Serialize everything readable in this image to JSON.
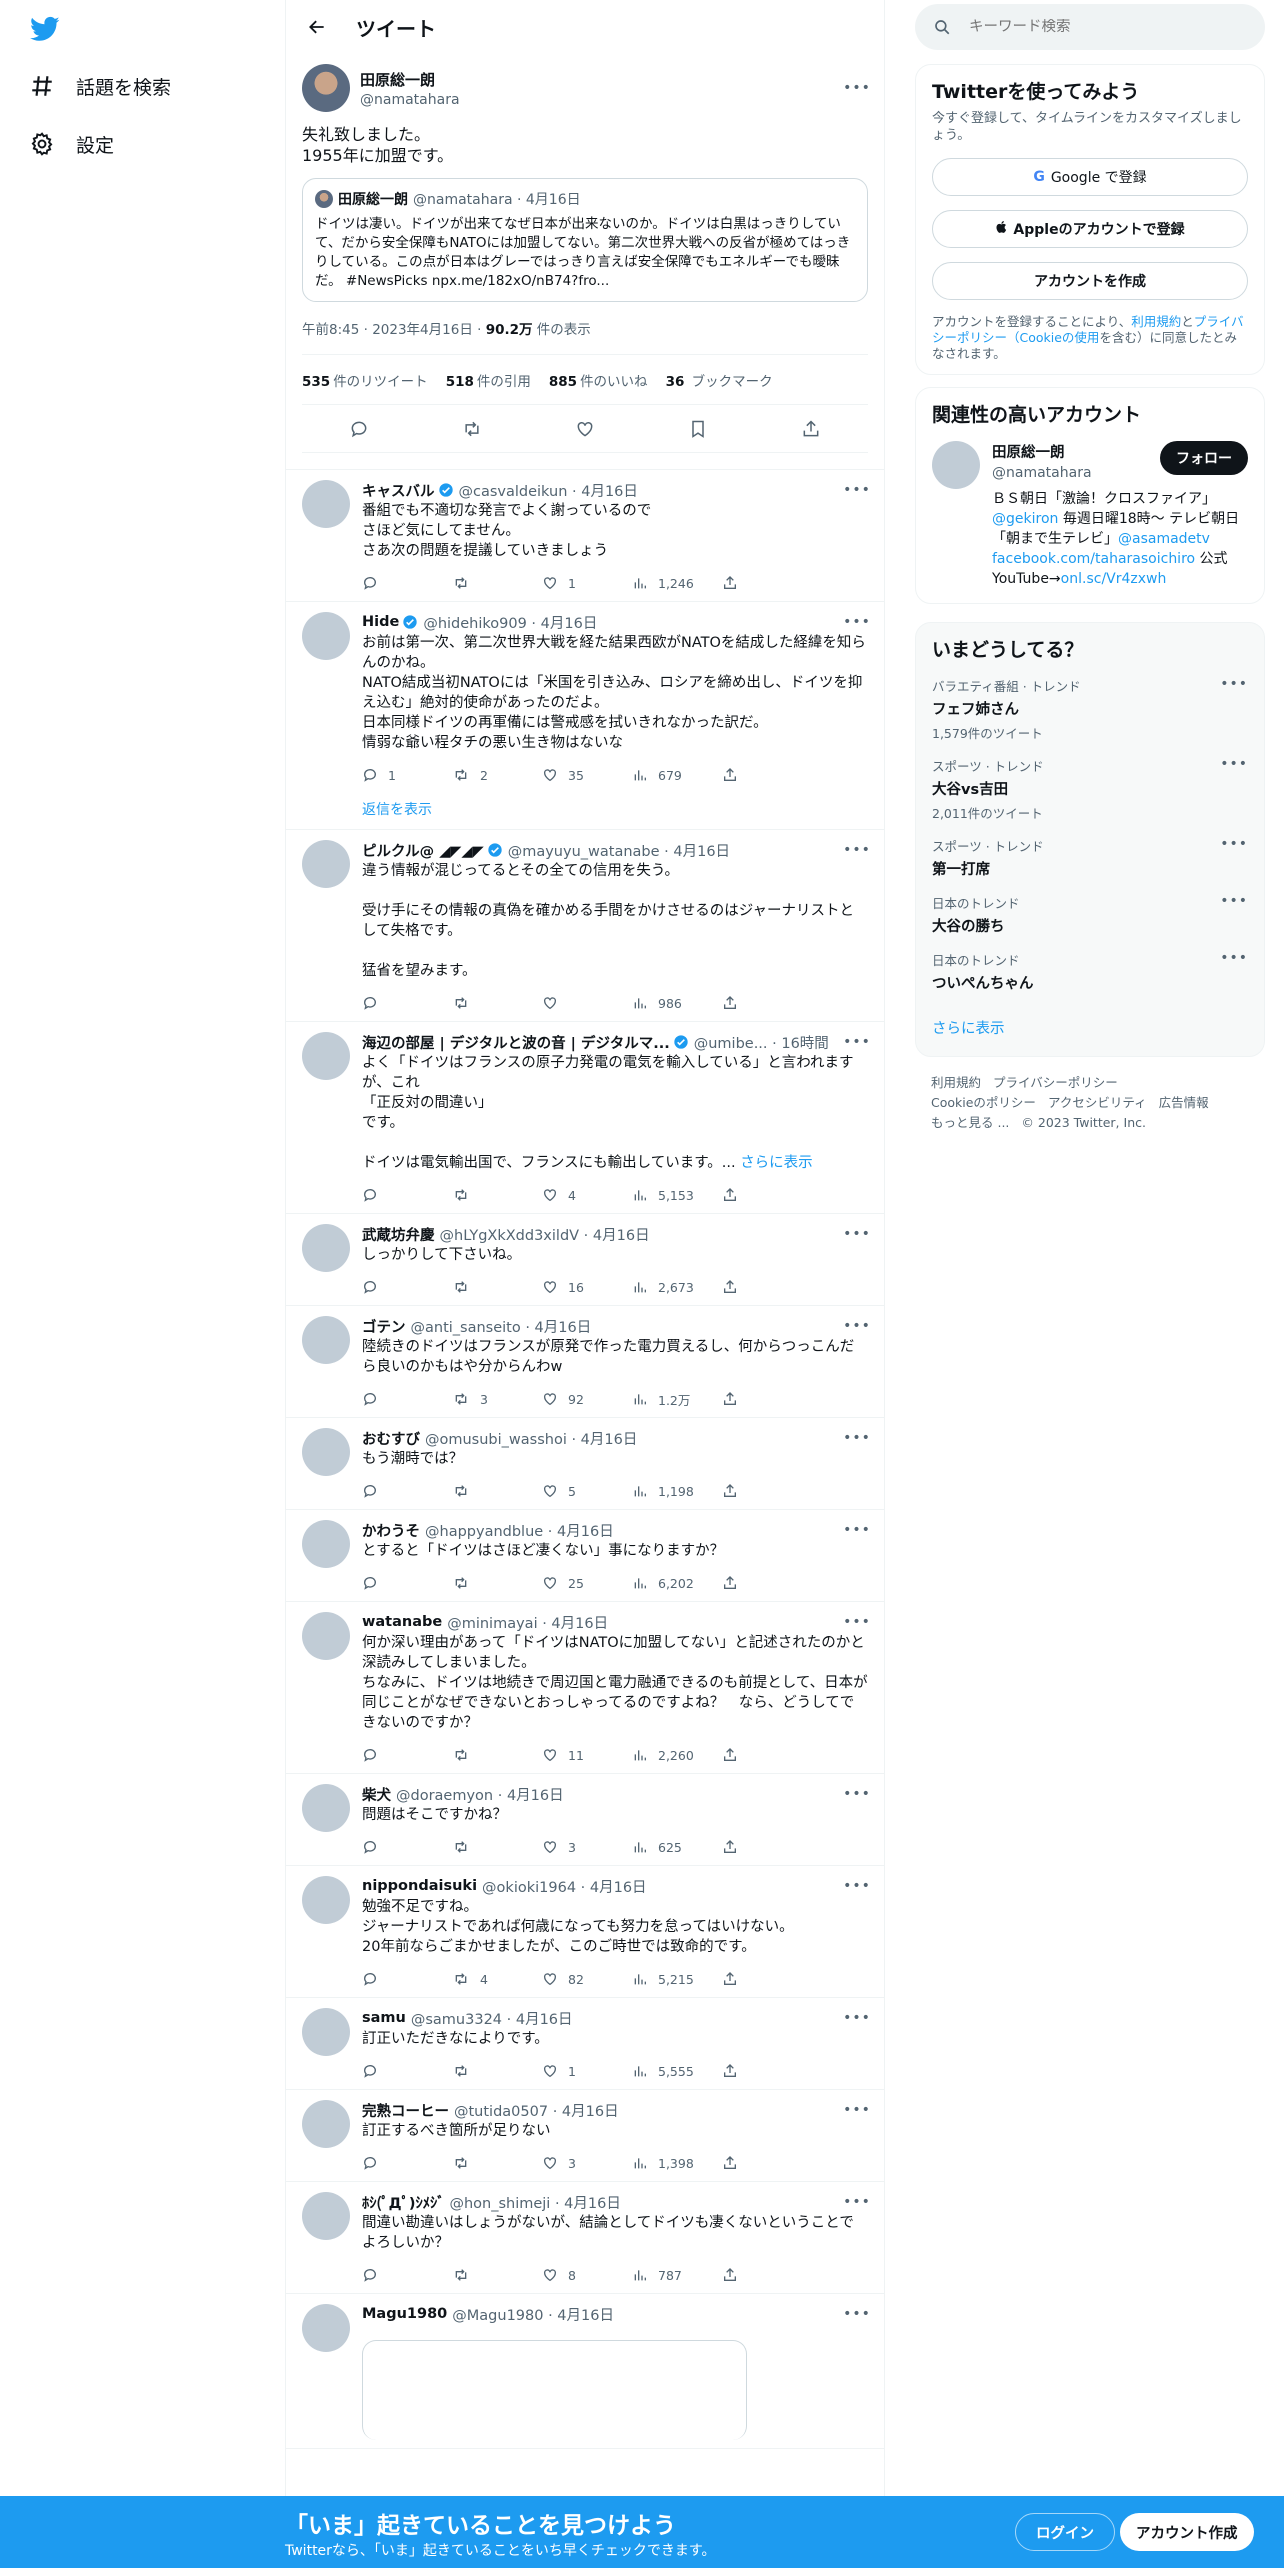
{
  "nav": {
    "explore": "話題を検索",
    "settings": "設定"
  },
  "header": {
    "title": "ツイート"
  },
  "focal": {
    "name": "田原総一朗",
    "handle": "@namatahara",
    "text": "失礼致しました。\n1955年に加盟です。",
    "quote": {
      "name": "田原総一朗",
      "meta": "@namatahara · 4月16日",
      "text": "ドイツは凄い。ドイツが出来てなぜ日本が出来ないのか。ドイツは白黒はっきりしていて、だから安全保障もNATOには加盟してない。第二次世界大戦への反省が極めてはっきりしている。この点が日本はグレーではっきり言えば安全保障でもエネルギーでも曖昧だ。 #NewsPicks npx.me/182xO/nB74?fro..."
    },
    "time": "午前8:45 · 2023年4月16日 · ",
    "views": "90.2万",
    "views_label": " 件の表示",
    "stats": {
      "retweets": "535",
      "retweets_label": "件のリツイート",
      "quotes": "518",
      "quotes_label": "件の引用",
      "likes": "885",
      "likes_label": "件のいいね",
      "bookmarks": "36",
      "bookmarks_label": "ブックマーク"
    }
  },
  "replies": [
    {
      "name": "キャスバル",
      "handle": "@casvaldeikun · 4月16日",
      "verified": true,
      "text": "番組でも不適切な発言でよく謝っているので\nさほど気にしてません。\nさあ次の問題を提議していきましょう",
      "reply": "",
      "rt": "",
      "like": "1",
      "views": "1,246"
    },
    {
      "name": "Hide",
      "handle": "@hidehiko909 · 4月16日",
      "verified": true,
      "text": "お前は第一次、第二次世界大戦を経た結果西欧がNATOを結成した経緯を知らんのかね。\nNATO結成当初NATOには「米国を引き込み、ロシアを締め出し、ドイツを抑え込む」絶対的使命があったのだよ。\n日本同様ドイツの再軍備には警戒感を拭いきれなかった訳だ。\n情弱な爺い程タチの悪い生き物はないな",
      "reply": "1",
      "rt": "2",
      "like": "35",
      "views": "679"
    },
    {
      "name": "ピルクル@ ◢◤◢◤",
      "handle": "@mayuyu_watanabe · 4月16日",
      "verified": true,
      "text": "違う情報が混じってるとその全ての信用を失う。\n\n受け手にその情報の真偽を確かめる手間をかけさせるのはジャーナリストとして失格です。\n\n猛省を望みます。",
      "reply": "",
      "rt": "",
      "like": "",
      "views": "986"
    },
    {
      "name": "海辺の部屋 | デジタルと波の音 | デジタルマ...",
      "handle": "@umibe... · 16時間",
      "verified": true,
      "text": "よく「ドイツはフランスの原子力発電の電気を輸入している」と言われますが、これ\n「正反対の間違い」\nです。\n\nドイツは電気輸出国で、フランスにも輸出しています。...",
      "more": "さらに表示",
      "reply": "",
      "rt": "",
      "like": "4",
      "views": "5,153"
    },
    {
      "name": "武蔵坊弁慶",
      "handle": "@hLYgXkXdd3xildV · 4月16日",
      "verified": false,
      "text": "しっかりして下さいね。",
      "reply": "",
      "rt": "",
      "like": "16",
      "views": "2,673"
    },
    {
      "name": "ゴテン",
      "handle": "@anti_sanseito · 4月16日",
      "verified": false,
      "text": "陸続きのドイツはフランスが原発で作った電力買えるし、何からつっこんだら良いのかもはや分からんわw",
      "reply": "",
      "rt": "3",
      "like": "92",
      "views": "1.2万"
    },
    {
      "name": "おむすび",
      "handle": "@omusubi_wasshoi · 4月16日",
      "verified": false,
      "text": "もう潮時では？",
      "reply": "",
      "rt": "",
      "like": "5",
      "views": "1,198"
    },
    {
      "name": "かわうそ",
      "handle": "@happyandblue · 4月16日",
      "verified": false,
      "text": "とすると「ドイツはさほど凄くない」事になりますか？",
      "reply": "",
      "rt": "",
      "like": "25",
      "views": "6,202"
    },
    {
      "name": "watanabe",
      "handle": "@minimayai · 4月16日",
      "verified": false,
      "text": "何か深い理由があって「ドイツはNATOに加盟してない」と記述されたのかと深読みしてしまいました。\nちなみに、ドイツは地続きで周辺国と電力融通できるのも前提として、日本が同じことがなぜできないとおっしゃってるのですよね？　なら、どうしてできないのですか？",
      "reply": "",
      "rt": "",
      "like": "11",
      "views": "2,260"
    },
    {
      "name": "柴犬",
      "handle": "@doraemyon · 4月16日",
      "verified": false,
      "text": "問題はそこですかね？",
      "reply": "",
      "rt": "",
      "like": "3",
      "views": "625"
    },
    {
      "name": "nippondaisuki",
      "handle": "@okioki1964 · 4月16日",
      "verified": false,
      "text": "勉強不足ですね。\nジャーナリストであれば何歳になっても努力を怠ってはいけない。\n20年前ならごまかせましたが、このご時世では致命的です。",
      "reply": "",
      "rt": "4",
      "like": "82",
      "views": "5,215"
    },
    {
      "name": "samu",
      "handle": "@samu3324 · 4月16日",
      "verified": false,
      "text": "訂正いただきなによりです。",
      "reply": "",
      "rt": "",
      "like": "1",
      "views": "5,555"
    },
    {
      "name": "完熟コーヒー",
      "handle": "@tutida0507 · 4月16日",
      "verified": false,
      "text": "訂正するべき箇所が足りない",
      "reply": "",
      "rt": "",
      "like": "3",
      "views": "1,398"
    },
    {
      "name": "ﾎｼ(ﾟДﾟ)ｼﾒｼﾞ",
      "handle": "@hon_shimeji · 4月16日",
      "verified": false,
      "text": "間違い勘違いはしょうがないが、結論としてドイツも凄くないということでよろしいか？",
      "reply": "",
      "rt": "",
      "like": "8",
      "views": "787"
    },
    {
      "name": "Magu1980",
      "handle": "@Magu1980 · 4月16日",
      "verified": false,
      "text": "",
      "reply": "",
      "rt": "",
      "like": "",
      "views": ""
    }
  ],
  "show_replies": "返信を表示",
  "right": {
    "search_placeholder": "キーワード検索",
    "signup": {
      "title": "Twitterを使ってみよう",
      "sub": "今すぐ登録して、タイムラインをカスタマイズしましょう。",
      "google": "Google で登録",
      "apple": "Appleのアカウントで登録",
      "create": "アカウントを作成",
      "note_a": "アカウントを登録することにより、",
      "note_terms": "利用規約",
      "note_b": "と",
      "note_privacy": "プライバシーポリシー（Cookieの使用",
      "note_c": "を含む）に同意したとみなされます。"
    },
    "related": {
      "title": "関連性の高いアカウント",
      "name": "田原総一朗",
      "handle": "@namatahara",
      "follow": "フォロー",
      "bio_a": "ＢＳ朝日「激論！クロスファイア」",
      "bio_gekiron": "@gekiron",
      "bio_b": " 毎週日曜18時～ テレビ朝日「朝まで生テレビ」",
      "bio_asamade": "@asamadetv",
      "bio_fb": "facebook.com/taharasoichiro",
      "bio_c": " 公式YouTube→",
      "bio_yt": "onl.sc/Vr4zxwh"
    },
    "trends": {
      "title": "いまどうしてる？",
      "items": [
        {
          "cat": "バラエティ番組 · トレンド",
          "name": "フェフ姉さん",
          "count": "1,579件のツイート"
        },
        {
          "cat": "スポーツ · トレンド",
          "name": "大谷vs吉田",
          "count": "2,011件のツイート"
        },
        {
          "cat": "スポーツ · トレンド",
          "name": "第一打席",
          "count": ""
        },
        {
          "cat": "日本のトレンド",
          "name": "大谷の勝ち",
          "count": ""
        },
        {
          "cat": "日本のトレンド",
          "name": "ついぺんちゃん",
          "count": ""
        }
      ],
      "show_more": "さらに表示"
    },
    "footer": {
      "terms": "利用規約",
      "privacy": "プライバシーポリシー",
      "cookie": "Cookieのポリシー",
      "access": "アクセシビリティ",
      "ads": "広告情報",
      "more": "もっと見る ...",
      "copy": "© 2023 Twitter, Inc."
    }
  },
  "bottom": {
    "title": "「いま」起きていることを見つけよう",
    "sub": "Twitterなら、「いま」起きていることをいち早くチェックできます。",
    "login": "ログイン",
    "signup": "アカウント作成"
  },
  "colors": {
    "accent": "#1d9bf0",
    "text": "#0f1419",
    "muted": "#536471"
  }
}
